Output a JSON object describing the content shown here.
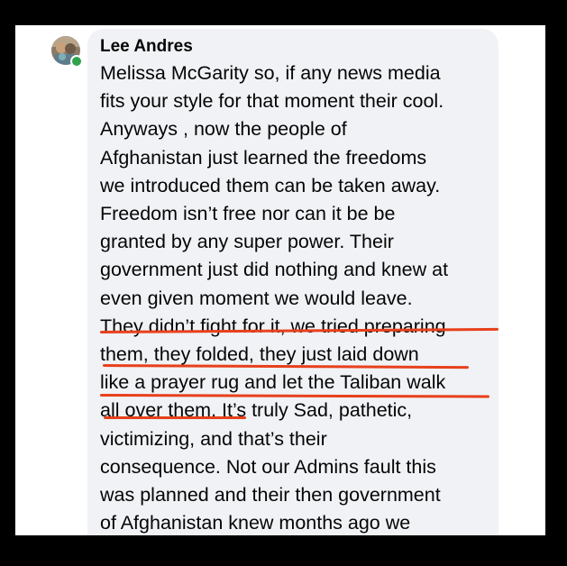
{
  "post": {
    "author": "Lee Andres",
    "lines": [
      "Melissa McGarity so, if any news media",
      "fits your style for that moment their cool.",
      "Anyways , now the people of",
      "Afghanistan just learned the freedoms",
      "we introduced them can be taken away.",
      "Freedom isn’t free nor can it be be",
      "granted by any super power. Their",
      "government just did nothing and knew at",
      "even given moment we would leave.",
      "They didn’t fight for it, we tried preparing",
      "them, they folded, they just laid down",
      "like a prayer rug and let the Taliban walk",
      "all over them. It’s truly Sad, pathetic,",
      "victimizing, and that’s their",
      "consequence. Not our Admins fault this",
      "was planned and their then government",
      "of Afghanistan knew months ago we"
    ]
  },
  "annotation": {
    "underline_color": "#e8401c",
    "presence_color": "#31a24c"
  }
}
